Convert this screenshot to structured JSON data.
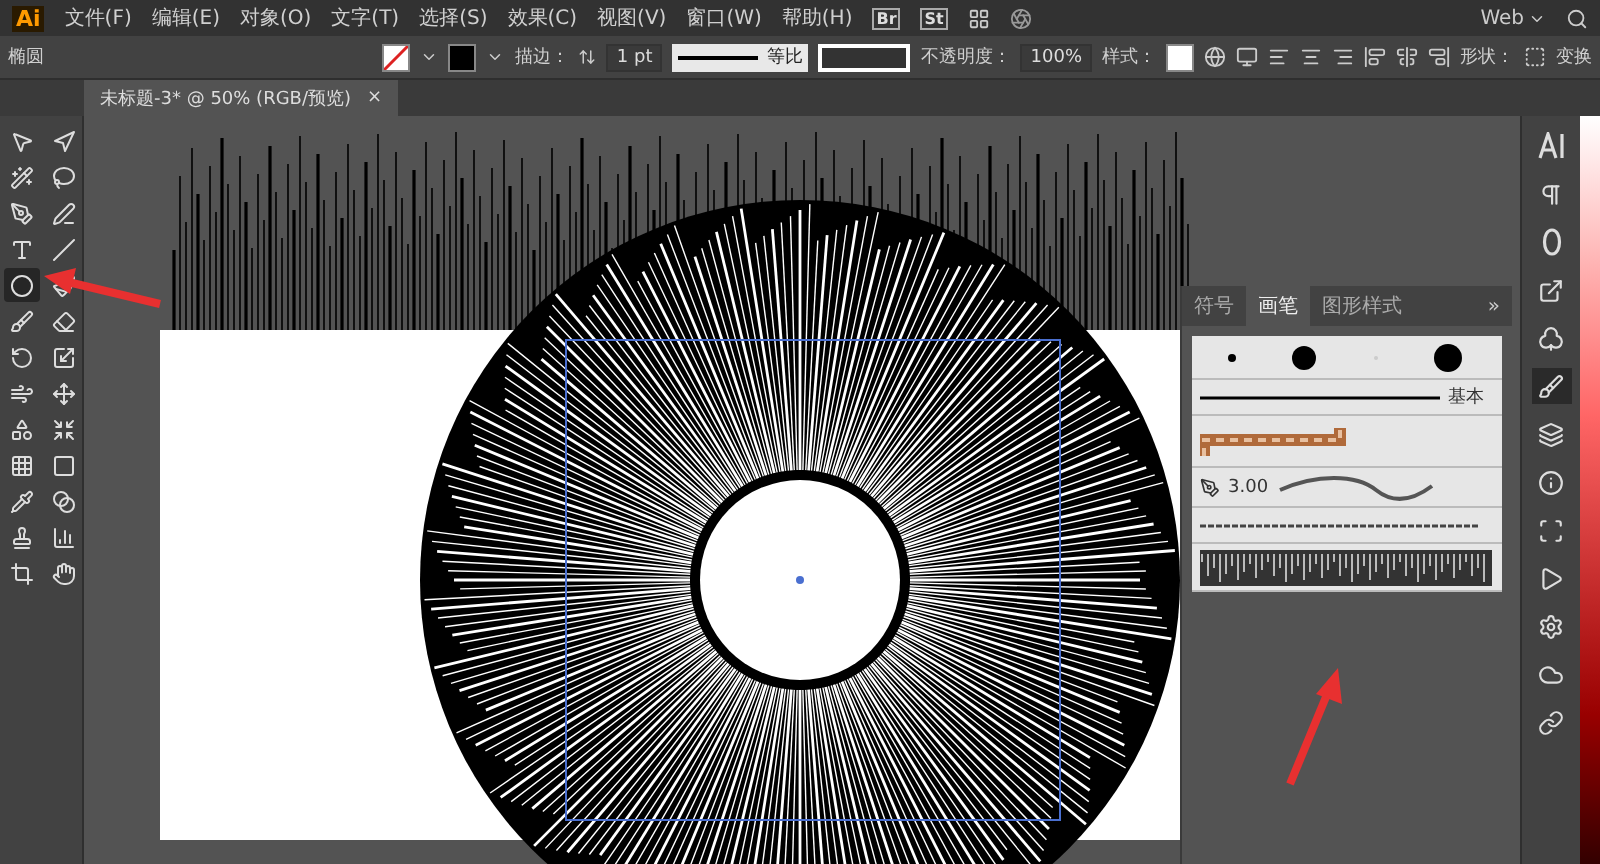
{
  "app": {
    "logo": "Ai"
  },
  "menu": [
    "文件(F)",
    "编辑(E)",
    "对象(O)",
    "文字(T)",
    "选择(S)",
    "效果(C)",
    "视图(V)",
    "窗口(W)",
    "帮助(H)"
  ],
  "bridge": {
    "bridge_label": "Br",
    "stock_label": "St",
    "workspace": "Web"
  },
  "control_bar": {
    "tool_name": "椭圆",
    "stroke_label": "描边：",
    "stroke_weight": "1 pt",
    "profile": "等比",
    "opacity_label": "不透明度：",
    "opacity": "100%",
    "style_label": "样式：",
    "shape_label": "形状：",
    "transform": "变换"
  },
  "document_tab": {
    "title": "未标题-3* @ 50% (RGB/预览)",
    "close": "×"
  },
  "tools": [
    {
      "selected": false
    },
    {
      "selected": false
    },
    {
      "selected": false
    },
    {
      "selected": false
    },
    {
      "selected": false
    },
    {
      "selected": false
    },
    {
      "selected": false
    },
    {
      "selected": false
    },
    {
      "selected": true
    },
    {
      "selected": false
    },
    {
      "selected": false
    },
    {
      "selected": false
    },
    {
      "selected": false
    },
    {
      "selected": false
    },
    {
      "selected": false
    },
    {
      "selected": false
    },
    {
      "selected": false
    },
    {
      "selected": false
    },
    {
      "selected": false
    },
    {
      "selected": false
    },
    {
      "selected": false
    },
    {
      "selected": false
    },
    {
      "selected": false
    },
    {
      "selected": false
    },
    {
      "selected": false
    },
    {
      "selected": false
    }
  ],
  "brush_panel": {
    "tabs": [
      {
        "label": "符号",
        "selected": false
      },
      {
        "label": "画笔",
        "selected": true
      },
      {
        "label": "图形样式",
        "selected": false
      }
    ],
    "more": "»",
    "basic_label": "基本",
    "calligraphic_size": "3.00"
  },
  "right_dock": [
    {
      "selected": false
    },
    {
      "selected": false
    },
    {
      "selected": false
    },
    {
      "selected": false
    },
    {
      "selected": false
    },
    {
      "selected": true
    },
    {
      "selected": false
    },
    {
      "selected": false
    },
    {
      "selected": false
    },
    {
      "selected": false
    },
    {
      "selected": false
    },
    {
      "selected": false
    },
    {
      "selected": false
    }
  ]
}
